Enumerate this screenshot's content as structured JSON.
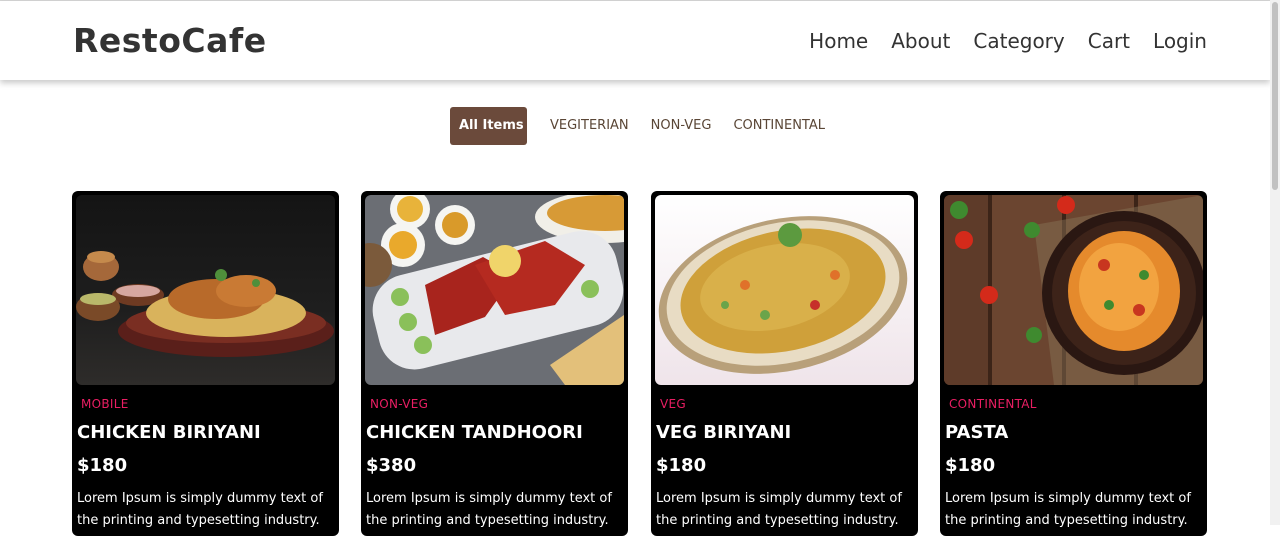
{
  "brand": "RestoCafe",
  "nav": [
    "Home",
    "About",
    "Category",
    "Cart",
    "Login"
  ],
  "filters": [
    "All Items",
    "VEGITERIAN",
    "NON-VEG",
    "CONTINENTAL"
  ],
  "active_filter": "All Items",
  "colors": {
    "accent_brown": "#6b4a3b",
    "category_pink": "#e91e63",
    "card_bg": "#000000"
  },
  "cards": [
    {
      "image": "chicken-biriyani-image",
      "category": "MOBILE",
      "title": "CHICKEN BIRIYANI",
      "price": "$180",
      "description": "Lorem Ipsum is simply dummy text of the printing and typesetting industry."
    },
    {
      "image": "chicken-tandhoori-image",
      "category": "NON-VEG",
      "title": "CHICKEN TANDHOORI",
      "price": "$380",
      "description": "Lorem Ipsum is simply dummy text of the printing and typesetting industry."
    },
    {
      "image": "veg-biriyani-image",
      "category": "VEG",
      "title": "VEG BIRIYANI",
      "price": "$180",
      "description": "Lorem Ipsum is simply dummy text of the printing and typesetting industry."
    },
    {
      "image": "pasta-image",
      "category": "CONTINENTAL",
      "title": "PASTA",
      "price": "$180",
      "description": "Lorem Ipsum is simply dummy text of the printing and typesetting industry."
    }
  ]
}
